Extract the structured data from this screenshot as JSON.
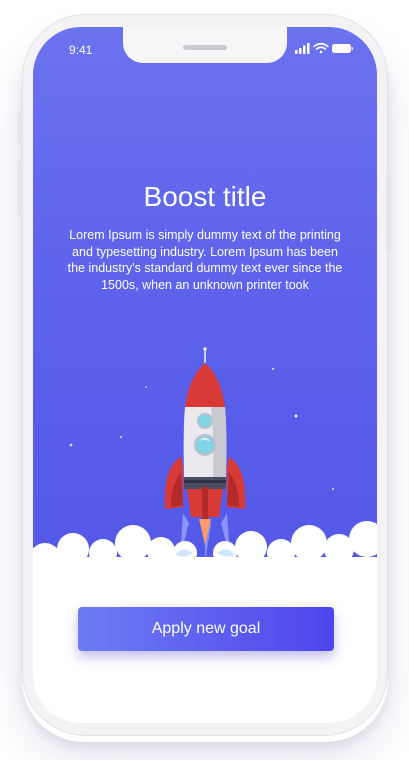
{
  "status_bar": {
    "time": "9:41",
    "signal_icon": "signal-bars-icon",
    "wifi_icon": "wifi-icon",
    "battery_icon": "battery-icon"
  },
  "hero": {
    "title": "Boost title",
    "body": "Lorem Ipsum is simply dummy text of the printing and typesetting industry. Lorem Ipsum has been the industry's standard dummy text ever since the 1500s, when an unknown printer took",
    "illustration": "rocket-launch-illustration"
  },
  "action": {
    "label": "Apply new goal"
  },
  "colors": {
    "hero_gradient_top": "#6b72ee",
    "hero_gradient_bottom": "#5257e6",
    "button_gradient_start": "#6d7cf3",
    "button_gradient_end": "#4e45ec",
    "text": "#ffffff"
  }
}
